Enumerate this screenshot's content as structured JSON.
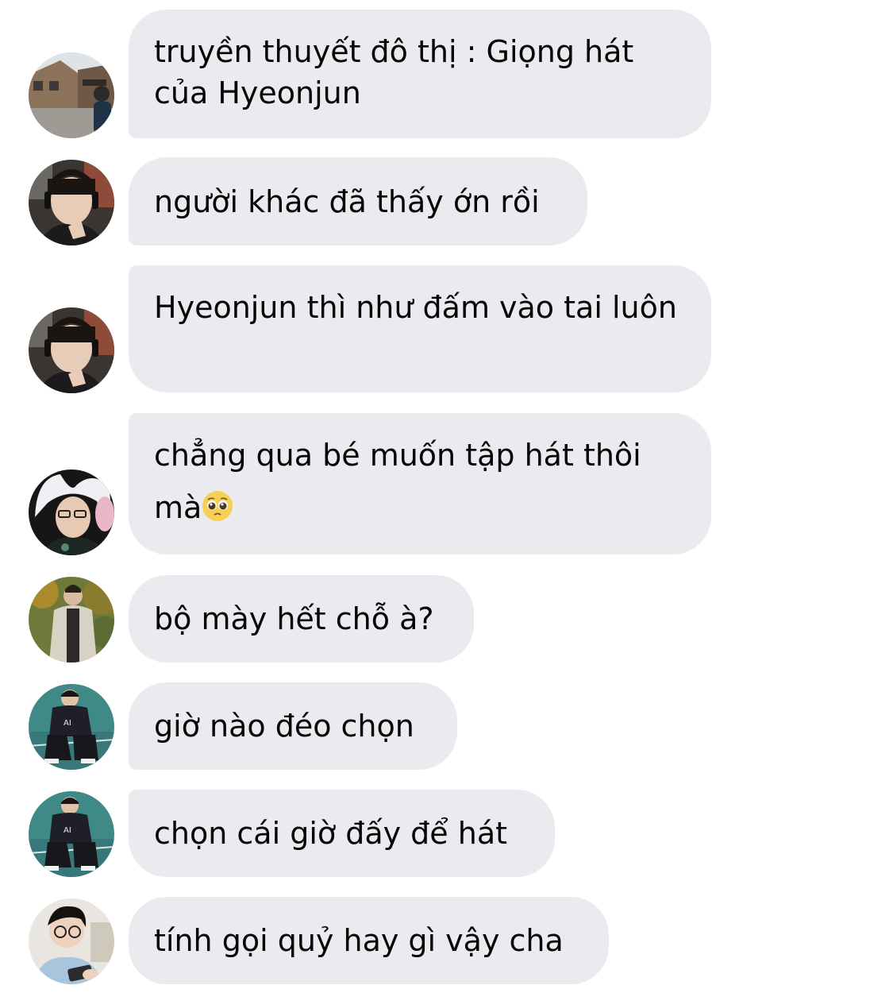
{
  "messages": [
    {
      "text": "truyền thuyết đô thị : Giọng hát của Hyeonjun",
      "avatar": "avatar-street-photo"
    },
    {
      "text": "người khác đã thấy ớn rồi",
      "avatar": "avatar-headset-gamer"
    },
    {
      "text": "Hyeonjun thì như đấm vào tai luôn",
      "avatar": "avatar-headset-gamer"
    },
    {
      "text": "chẳng qua bé muốn tập hát thôi mà",
      "emoji": "pleading-face-emoji",
      "avatar": "avatar-bunny-hat"
    },
    {
      "text": "bộ mày hết chỗ à?",
      "avatar": "avatar-autumn-coat"
    },
    {
      "text": "giờ nào đéo chọn",
      "avatar": "avatar-crouching-jersey"
    },
    {
      "text": "chọn cái giờ đấy để hát",
      "avatar": "avatar-crouching-jersey"
    },
    {
      "text": "tính gọi quỷ hay gì vậy cha",
      "avatar": "avatar-glasses-phone"
    }
  ],
  "colors": {
    "bubble_bg": "#e9ebee",
    "text": "#050505",
    "page_bg": "#ffffff"
  }
}
